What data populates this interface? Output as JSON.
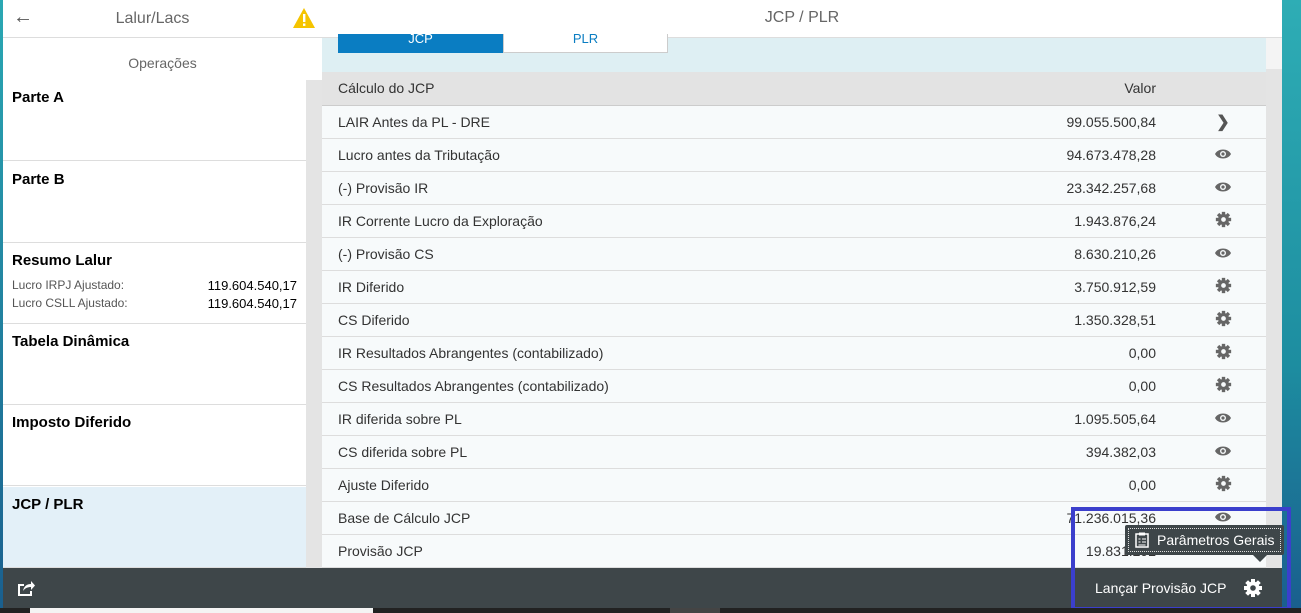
{
  "left": {
    "title": "Lalur/Lacs",
    "section": "Operações",
    "tiles": [
      {
        "label": "Parte A"
      },
      {
        "label": "Parte B"
      },
      {
        "label": "Resumo Lalur",
        "rows": [
          {
            "k": "Lucro IRPJ Ajustado:",
            "v": "119.604.540,17"
          },
          {
            "k": "Lucro CSLL Ajustado:",
            "v": "119.604.540,17"
          }
        ]
      },
      {
        "label": "Tabela Dinâmica"
      },
      {
        "label": "Imposto Diferido"
      },
      {
        "label": "JCP / PLR"
      }
    ]
  },
  "main": {
    "title": "JCP / PLR",
    "tabs": [
      "JCP",
      "PLR"
    ],
    "columns": [
      "Cálculo do JCP",
      "Valor"
    ],
    "rows": [
      {
        "label": "LAIR Antes da PL - DRE",
        "value": "99.055.500,84",
        "icon": "chevron-right"
      },
      {
        "label": "Lucro antes da Tributação",
        "value": "94.673.478,28",
        "icon": "eye"
      },
      {
        "label": "(-) Provisão IR",
        "value": "23.342.257,68",
        "icon": "eye"
      },
      {
        "label": "IR Corrente Lucro da Exploração",
        "value": "1.943.876,24",
        "icon": "gear"
      },
      {
        "label": "(-) Provisão CS",
        "value": "8.630.210,26",
        "icon": "eye"
      },
      {
        "label": "IR Diferido",
        "value": "3.750.912,59",
        "icon": "gear"
      },
      {
        "label": "CS Diferido",
        "value": "1.350.328,51",
        "icon": "gear"
      },
      {
        "label": "IR Resultados Abrangentes (contabilizado)",
        "value": "0,00",
        "icon": "gear"
      },
      {
        "label": "CS Resultados Abrangentes (contabilizado)",
        "value": "0,00",
        "icon": "gear"
      },
      {
        "label": "IR diferida sobre PL",
        "value": "1.095.505,64",
        "icon": "eye"
      },
      {
        "label": "CS diferida sobre PL",
        "value": "394.382,03",
        "icon": "eye"
      },
      {
        "label": "Ajuste Diferido",
        "value": "0,00",
        "icon": "gear"
      },
      {
        "label": "Base de Cálculo JCP",
        "value": "71.236.015,36",
        "icon": "eye"
      },
      {
        "label": "Provisão JCP",
        "value": "19.831.292",
        "icon": "eye"
      }
    ]
  },
  "footer": {
    "launch": "Lançar Provisão JCP",
    "tooltip": "Parâmetros Gerais"
  }
}
